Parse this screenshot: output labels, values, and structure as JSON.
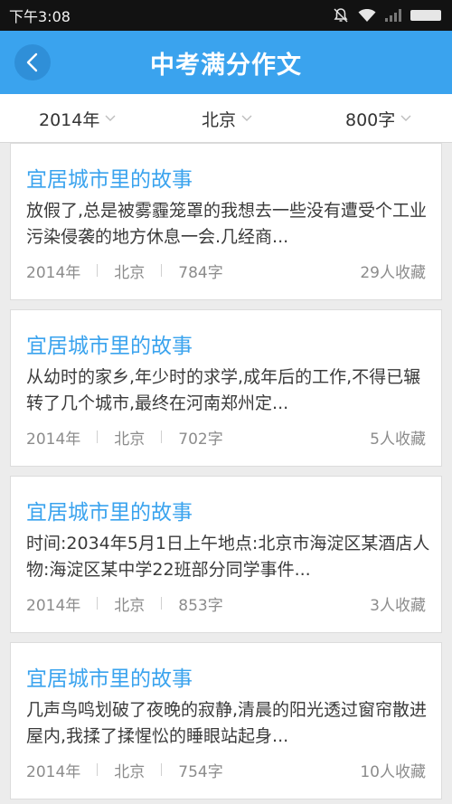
{
  "status_bar": {
    "time": "下午3:08",
    "icons": [
      "mute-icon",
      "wifi-icon",
      "signal-icon",
      "battery-icon"
    ]
  },
  "header": {
    "title": "中考满分作文",
    "back_icon": "chevron-left-icon"
  },
  "filters": {
    "year": "2014年",
    "city": "北京",
    "words": "800字"
  },
  "articles": [
    {
      "title": "宜居城市里的故事",
      "excerpt": "放假了,总是被雾霾笼罩的我想去一些没有遭受个工业污染侵袭的地方休息一会.几经商...",
      "year": "2014年",
      "city": "北京",
      "words": "784字",
      "favorites": "29人收藏"
    },
    {
      "title": "宜居城市里的故事",
      "excerpt": "从幼时的家乡,年少时的求学,成年后的工作,不得已辗转了几个城市,最终在河南郑州定...",
      "year": "2014年",
      "city": "北京",
      "words": "702字",
      "favorites": "5人收藏"
    },
    {
      "title": "宜居城市里的故事",
      "excerpt": "时间:2034年5月1日上午地点:北京市海淀区某酒店人物:海淀区某中学22班部分同学事件...",
      "year": "2014年",
      "city": "北京",
      "words": "853字",
      "favorites": "3人收藏"
    },
    {
      "title": "宜居城市里的故事",
      "excerpt": "几声鸟鸣划破了夜晚的寂静,清晨的阳光透过窗帘散进屋内,我揉了揉惺忪的睡眼站起身...",
      "year": "2014年",
      "city": "北京",
      "words": "754字",
      "favorites": "10人收藏"
    }
  ],
  "colors": {
    "accent": "#3aa3ee",
    "background": "#ececec",
    "status_bar": "#121212"
  }
}
